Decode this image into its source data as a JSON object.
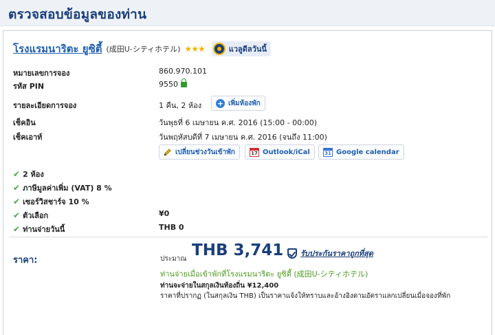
{
  "header": {
    "title": "ตรวจสอบข้อมูลของท่าน"
  },
  "hotel": {
    "name": "โรงแรมนาริตะ ยูซิตี้",
    "subname": "(成田U-シティホテル)",
    "stars": "★★★",
    "deal_badge": "แวลูดีลวันนี้"
  },
  "details": {
    "booking_number_label": "หมายเลขการจอง",
    "booking_number": "860.970.101",
    "pin_label": "รหัส PIN",
    "pin": "9550",
    "booking_detail_label": "รายละเอียดการจอง",
    "booking_detail": "1 คืน, 2 ห้อง",
    "add_room_button": "เพิ่มห้องพัก",
    "checkin_label": "เช็คอิน",
    "checkin": "วันพุธที่ 6 เมษายน ค.ศ. 2016 (15:00 - 00:00)",
    "checkout_label": "เช็คเอาท์",
    "checkout": "วันพฤหัสบดีที่ 7 เมษายน ค.ศ. 2016 (จนถึง 11:00)",
    "change_dates_button": "เปลี่ยนช่วงวันเข้าพัก",
    "outlook_button": "Outlook/iCal",
    "google_button": "Google calendar"
  },
  "features": [
    {
      "label": "2 ห้อง",
      "value": ""
    },
    {
      "label": "ภาษีมูลค่าเพิ่ม (VAT) 8 %",
      "value": ""
    },
    {
      "label": "เซอร์วิสชาร์จ 10 %",
      "value": ""
    },
    {
      "label": "ตัวเลือก",
      "value": "¥0"
    },
    {
      "label": "ท่านจ่ายวันนี้",
      "value": "THB 0"
    }
  ],
  "price": {
    "label": "ราคา:",
    "approx": "ประมาณ",
    "amount": "THB 3,741",
    "guarantee": "รับประกันราคาถูกที่สุด",
    "pay_at_hotel": "ท่านจ่ายเมื่อเข้าพักที่โรงแรมนาริตะ ยูซิตี้ (成田U-シティホテル)",
    "local_currency": "ท่านจะจ่ายในสกุลเงินท้องถิ่น  ¥12,400",
    "note": "ราคาที่ปรากฏ (ในสกุลเงิน THB) เป็นราคาแจ้งให้ทราบและอ้างอิงตามอัตราแลกเปลี่ยนเมื่อจองที่พัก"
  },
  "colors": {
    "accent": "#1a3f7a",
    "link": "#1f5fb0",
    "success": "#49a647",
    "star": "#f0b400"
  }
}
